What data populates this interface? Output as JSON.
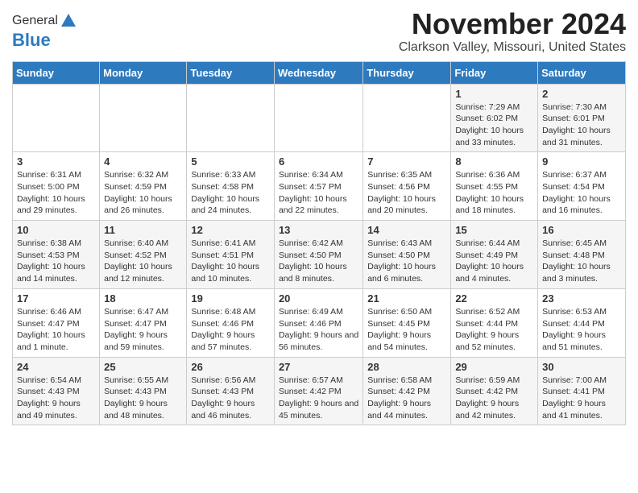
{
  "header": {
    "logo_general": "General",
    "logo_blue": "Blue",
    "month_title": "November 2024",
    "location": "Clarkson Valley, Missouri, United States"
  },
  "days_of_week": [
    "Sunday",
    "Monday",
    "Tuesday",
    "Wednesday",
    "Thursday",
    "Friday",
    "Saturday"
  ],
  "weeks": [
    [
      {
        "day": "",
        "detail": ""
      },
      {
        "day": "",
        "detail": ""
      },
      {
        "day": "",
        "detail": ""
      },
      {
        "day": "",
        "detail": ""
      },
      {
        "day": "",
        "detail": ""
      },
      {
        "day": "1",
        "detail": "Sunrise: 7:29 AM\nSunset: 6:02 PM\nDaylight: 10 hours and 33 minutes."
      },
      {
        "day": "2",
        "detail": "Sunrise: 7:30 AM\nSunset: 6:01 PM\nDaylight: 10 hours and 31 minutes."
      }
    ],
    [
      {
        "day": "3",
        "detail": "Sunrise: 6:31 AM\nSunset: 5:00 PM\nDaylight: 10 hours and 29 minutes."
      },
      {
        "day": "4",
        "detail": "Sunrise: 6:32 AM\nSunset: 4:59 PM\nDaylight: 10 hours and 26 minutes."
      },
      {
        "day": "5",
        "detail": "Sunrise: 6:33 AM\nSunset: 4:58 PM\nDaylight: 10 hours and 24 minutes."
      },
      {
        "day": "6",
        "detail": "Sunrise: 6:34 AM\nSunset: 4:57 PM\nDaylight: 10 hours and 22 minutes."
      },
      {
        "day": "7",
        "detail": "Sunrise: 6:35 AM\nSunset: 4:56 PM\nDaylight: 10 hours and 20 minutes."
      },
      {
        "day": "8",
        "detail": "Sunrise: 6:36 AM\nSunset: 4:55 PM\nDaylight: 10 hours and 18 minutes."
      },
      {
        "day": "9",
        "detail": "Sunrise: 6:37 AM\nSunset: 4:54 PM\nDaylight: 10 hours and 16 minutes."
      }
    ],
    [
      {
        "day": "10",
        "detail": "Sunrise: 6:38 AM\nSunset: 4:53 PM\nDaylight: 10 hours and 14 minutes."
      },
      {
        "day": "11",
        "detail": "Sunrise: 6:40 AM\nSunset: 4:52 PM\nDaylight: 10 hours and 12 minutes."
      },
      {
        "day": "12",
        "detail": "Sunrise: 6:41 AM\nSunset: 4:51 PM\nDaylight: 10 hours and 10 minutes."
      },
      {
        "day": "13",
        "detail": "Sunrise: 6:42 AM\nSunset: 4:50 PM\nDaylight: 10 hours and 8 minutes."
      },
      {
        "day": "14",
        "detail": "Sunrise: 6:43 AM\nSunset: 4:50 PM\nDaylight: 10 hours and 6 minutes."
      },
      {
        "day": "15",
        "detail": "Sunrise: 6:44 AM\nSunset: 4:49 PM\nDaylight: 10 hours and 4 minutes."
      },
      {
        "day": "16",
        "detail": "Sunrise: 6:45 AM\nSunset: 4:48 PM\nDaylight: 10 hours and 3 minutes."
      }
    ],
    [
      {
        "day": "17",
        "detail": "Sunrise: 6:46 AM\nSunset: 4:47 PM\nDaylight: 10 hours and 1 minute."
      },
      {
        "day": "18",
        "detail": "Sunrise: 6:47 AM\nSunset: 4:47 PM\nDaylight: 9 hours and 59 minutes."
      },
      {
        "day": "19",
        "detail": "Sunrise: 6:48 AM\nSunset: 4:46 PM\nDaylight: 9 hours and 57 minutes."
      },
      {
        "day": "20",
        "detail": "Sunrise: 6:49 AM\nSunset: 4:46 PM\nDaylight: 9 hours and 56 minutes."
      },
      {
        "day": "21",
        "detail": "Sunrise: 6:50 AM\nSunset: 4:45 PM\nDaylight: 9 hours and 54 minutes."
      },
      {
        "day": "22",
        "detail": "Sunrise: 6:52 AM\nSunset: 4:44 PM\nDaylight: 9 hours and 52 minutes."
      },
      {
        "day": "23",
        "detail": "Sunrise: 6:53 AM\nSunset: 4:44 PM\nDaylight: 9 hours and 51 minutes."
      }
    ],
    [
      {
        "day": "24",
        "detail": "Sunrise: 6:54 AM\nSunset: 4:43 PM\nDaylight: 9 hours and 49 minutes."
      },
      {
        "day": "25",
        "detail": "Sunrise: 6:55 AM\nSunset: 4:43 PM\nDaylight: 9 hours and 48 minutes."
      },
      {
        "day": "26",
        "detail": "Sunrise: 6:56 AM\nSunset: 4:43 PM\nDaylight: 9 hours and 46 minutes."
      },
      {
        "day": "27",
        "detail": "Sunrise: 6:57 AM\nSunset: 4:42 PM\nDaylight: 9 hours and 45 minutes."
      },
      {
        "day": "28",
        "detail": "Sunrise: 6:58 AM\nSunset: 4:42 PM\nDaylight: 9 hours and 44 minutes."
      },
      {
        "day": "29",
        "detail": "Sunrise: 6:59 AM\nSunset: 4:42 PM\nDaylight: 9 hours and 42 minutes."
      },
      {
        "day": "30",
        "detail": "Sunrise: 7:00 AM\nSunset: 4:41 PM\nDaylight: 9 hours and 41 minutes."
      }
    ]
  ]
}
